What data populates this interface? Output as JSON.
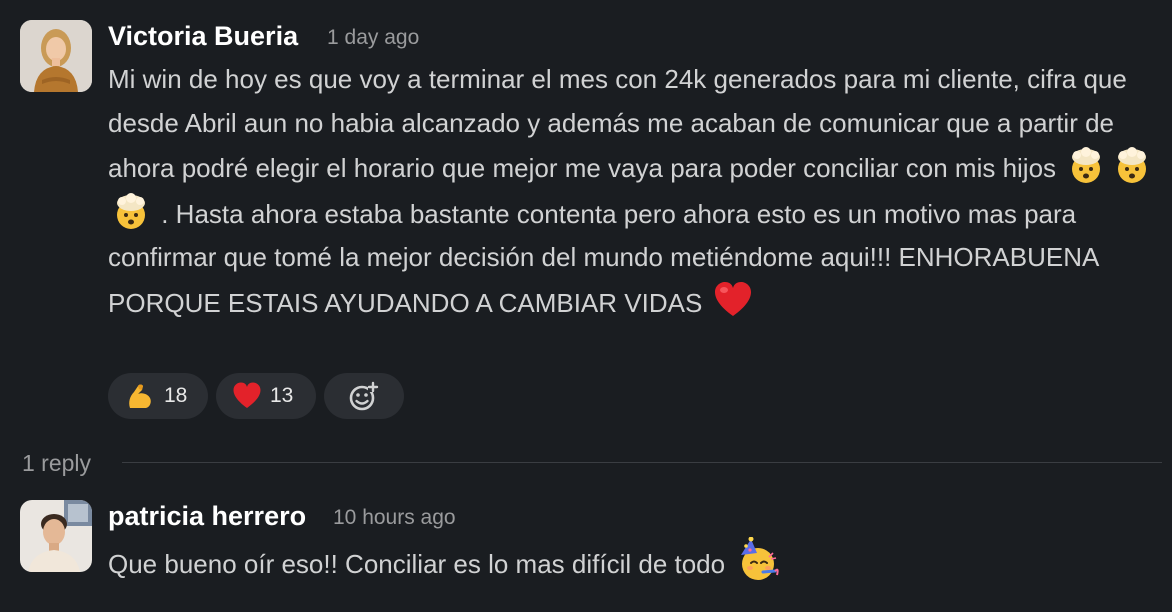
{
  "messages": [
    {
      "author": "Victoria Bueria",
      "time": "1 day ago",
      "text_part1": "Mi win de hoy es que voy a terminar el mes con 24k generados para mi cliente, cifra que desde Abril aun no habia alcanzado y además me acaban de comunicar que a partir de ahora podré elegir el horario que mejor me vaya para poder conciliar con mis hijos",
      "text_part2": ". Hasta ahora estaba bastante contenta pero ahora esto es un motivo mas para confirmar que tomé la mejor decisión del mundo metiéndome aqui!!! ENHORABUENA PORQUE ESTAIS AYUDANDO A CAMBIAR VIDAS",
      "inline_emojis": [
        "exploding-head-icon",
        "exploding-head-icon",
        "exploding-head-icon",
        "red-heart-icon"
      ],
      "reactions": [
        {
          "icon": "flexed-biceps-icon",
          "count": "18"
        },
        {
          "icon": "red-heart-icon",
          "count": "13"
        },
        {
          "icon": "add-reaction-icon",
          "count": ""
        }
      ]
    },
    {
      "author": "patricia herrero",
      "time": "10 hours ago",
      "text_part1": "Que bueno oír eso!! Conciliar es lo mas difícil de todo",
      "inline_emojis": [
        "partying-face-icon"
      ]
    }
  ],
  "thread": {
    "replies_label": "1 reply"
  },
  "colors": {
    "background": "#1a1d21",
    "text": "#d1d2d3",
    "name": "#ffffff",
    "muted": "#9a9b9d",
    "reaction_bg": "#2b2e33"
  }
}
